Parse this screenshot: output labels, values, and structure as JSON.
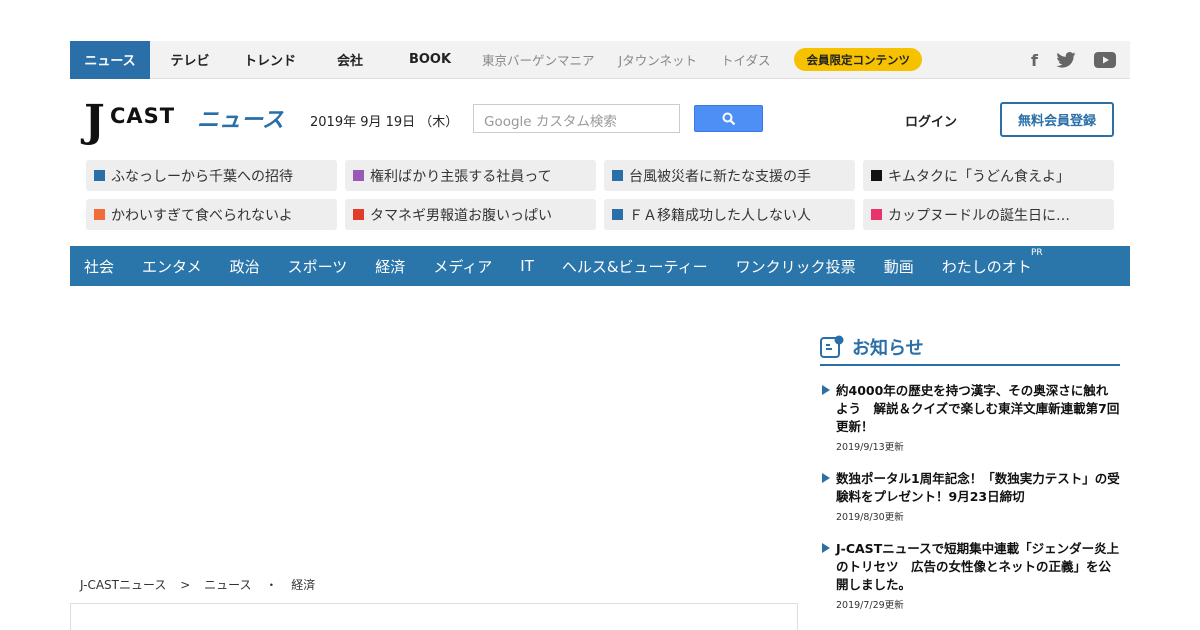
{
  "topbar": {
    "tabs": [
      "ニュース",
      "テレビ",
      "トレンド",
      "会社",
      "BOOK"
    ],
    "external": [
      "東京バーゲンマニア",
      "Jタウンネット",
      "トイダス"
    ],
    "premium": "会員限定コンテンツ",
    "social": [
      "facebook-icon",
      "twitter-icon",
      "youtube-icon"
    ]
  },
  "header": {
    "logo_j": "J",
    "logo_cast": "CAST",
    "logo_news": "ニュース",
    "date": "2019年 9月 19日 （木）",
    "search_placeholder": "Google カスタム検索",
    "login": "ログイン",
    "register": "無料会員登録"
  },
  "pickups": [
    {
      "label": "ふなっしーから千葉への招待",
      "color": "#2a6fa8"
    },
    {
      "label": "権利ばかり主張する社員って",
      "color": "#9b59b6"
    },
    {
      "label": "台風被災者に新たな支援の手",
      "color": "#2a6fa8"
    },
    {
      "label": "キムタクに「うどん食えよ」",
      "color": "#111111"
    },
    {
      "label": "かわいすぎて食べられないよ",
      "color": "#f26b3a"
    },
    {
      "label": "タマネギ男報道お腹いっぱい",
      "color": "#e03c28"
    },
    {
      "label": "ＦＡ移籍成功した人しない人",
      "color": "#2a6fa8"
    },
    {
      "label": "カップヌードルの誕生日に…",
      "color": "#e8336d"
    }
  ],
  "categories": [
    "社会",
    "エンタメ",
    "政治",
    "スポーツ",
    "経済",
    "メディア",
    "IT",
    "ヘルス&ビューティー",
    "ワンクリック投票",
    "動画",
    "わたしのオト"
  ],
  "pr_label": "PR",
  "breadcrumb": [
    "J-CASTニュース",
    ">",
    "ニュース",
    "・",
    "経済"
  ],
  "notices": {
    "title": "お知らせ",
    "items": [
      {
        "text": "約4000年の歴史を持つ漢字、その奥深さに触れよう　解説＆クイズで楽しむ東洋文庫新連載第7回更新！",
        "date": "2019/9/13更新"
      },
      {
        "text": "数独ポータル1周年記念！「数独実力テスト」の受験料をプレゼント！9月23日締切",
        "date": "2019/8/30更新"
      },
      {
        "text": "J-CASTニュースで短期集中連載「ジェンダー炎上のトリセツ　広告の女性像とネットの正義」を公開しました。",
        "date": "2019/7/29更新"
      }
    ]
  },
  "colors": {
    "brand": "#2a6fa8",
    "premium": "#f6c200",
    "search_button": "#4d8ff5"
  }
}
